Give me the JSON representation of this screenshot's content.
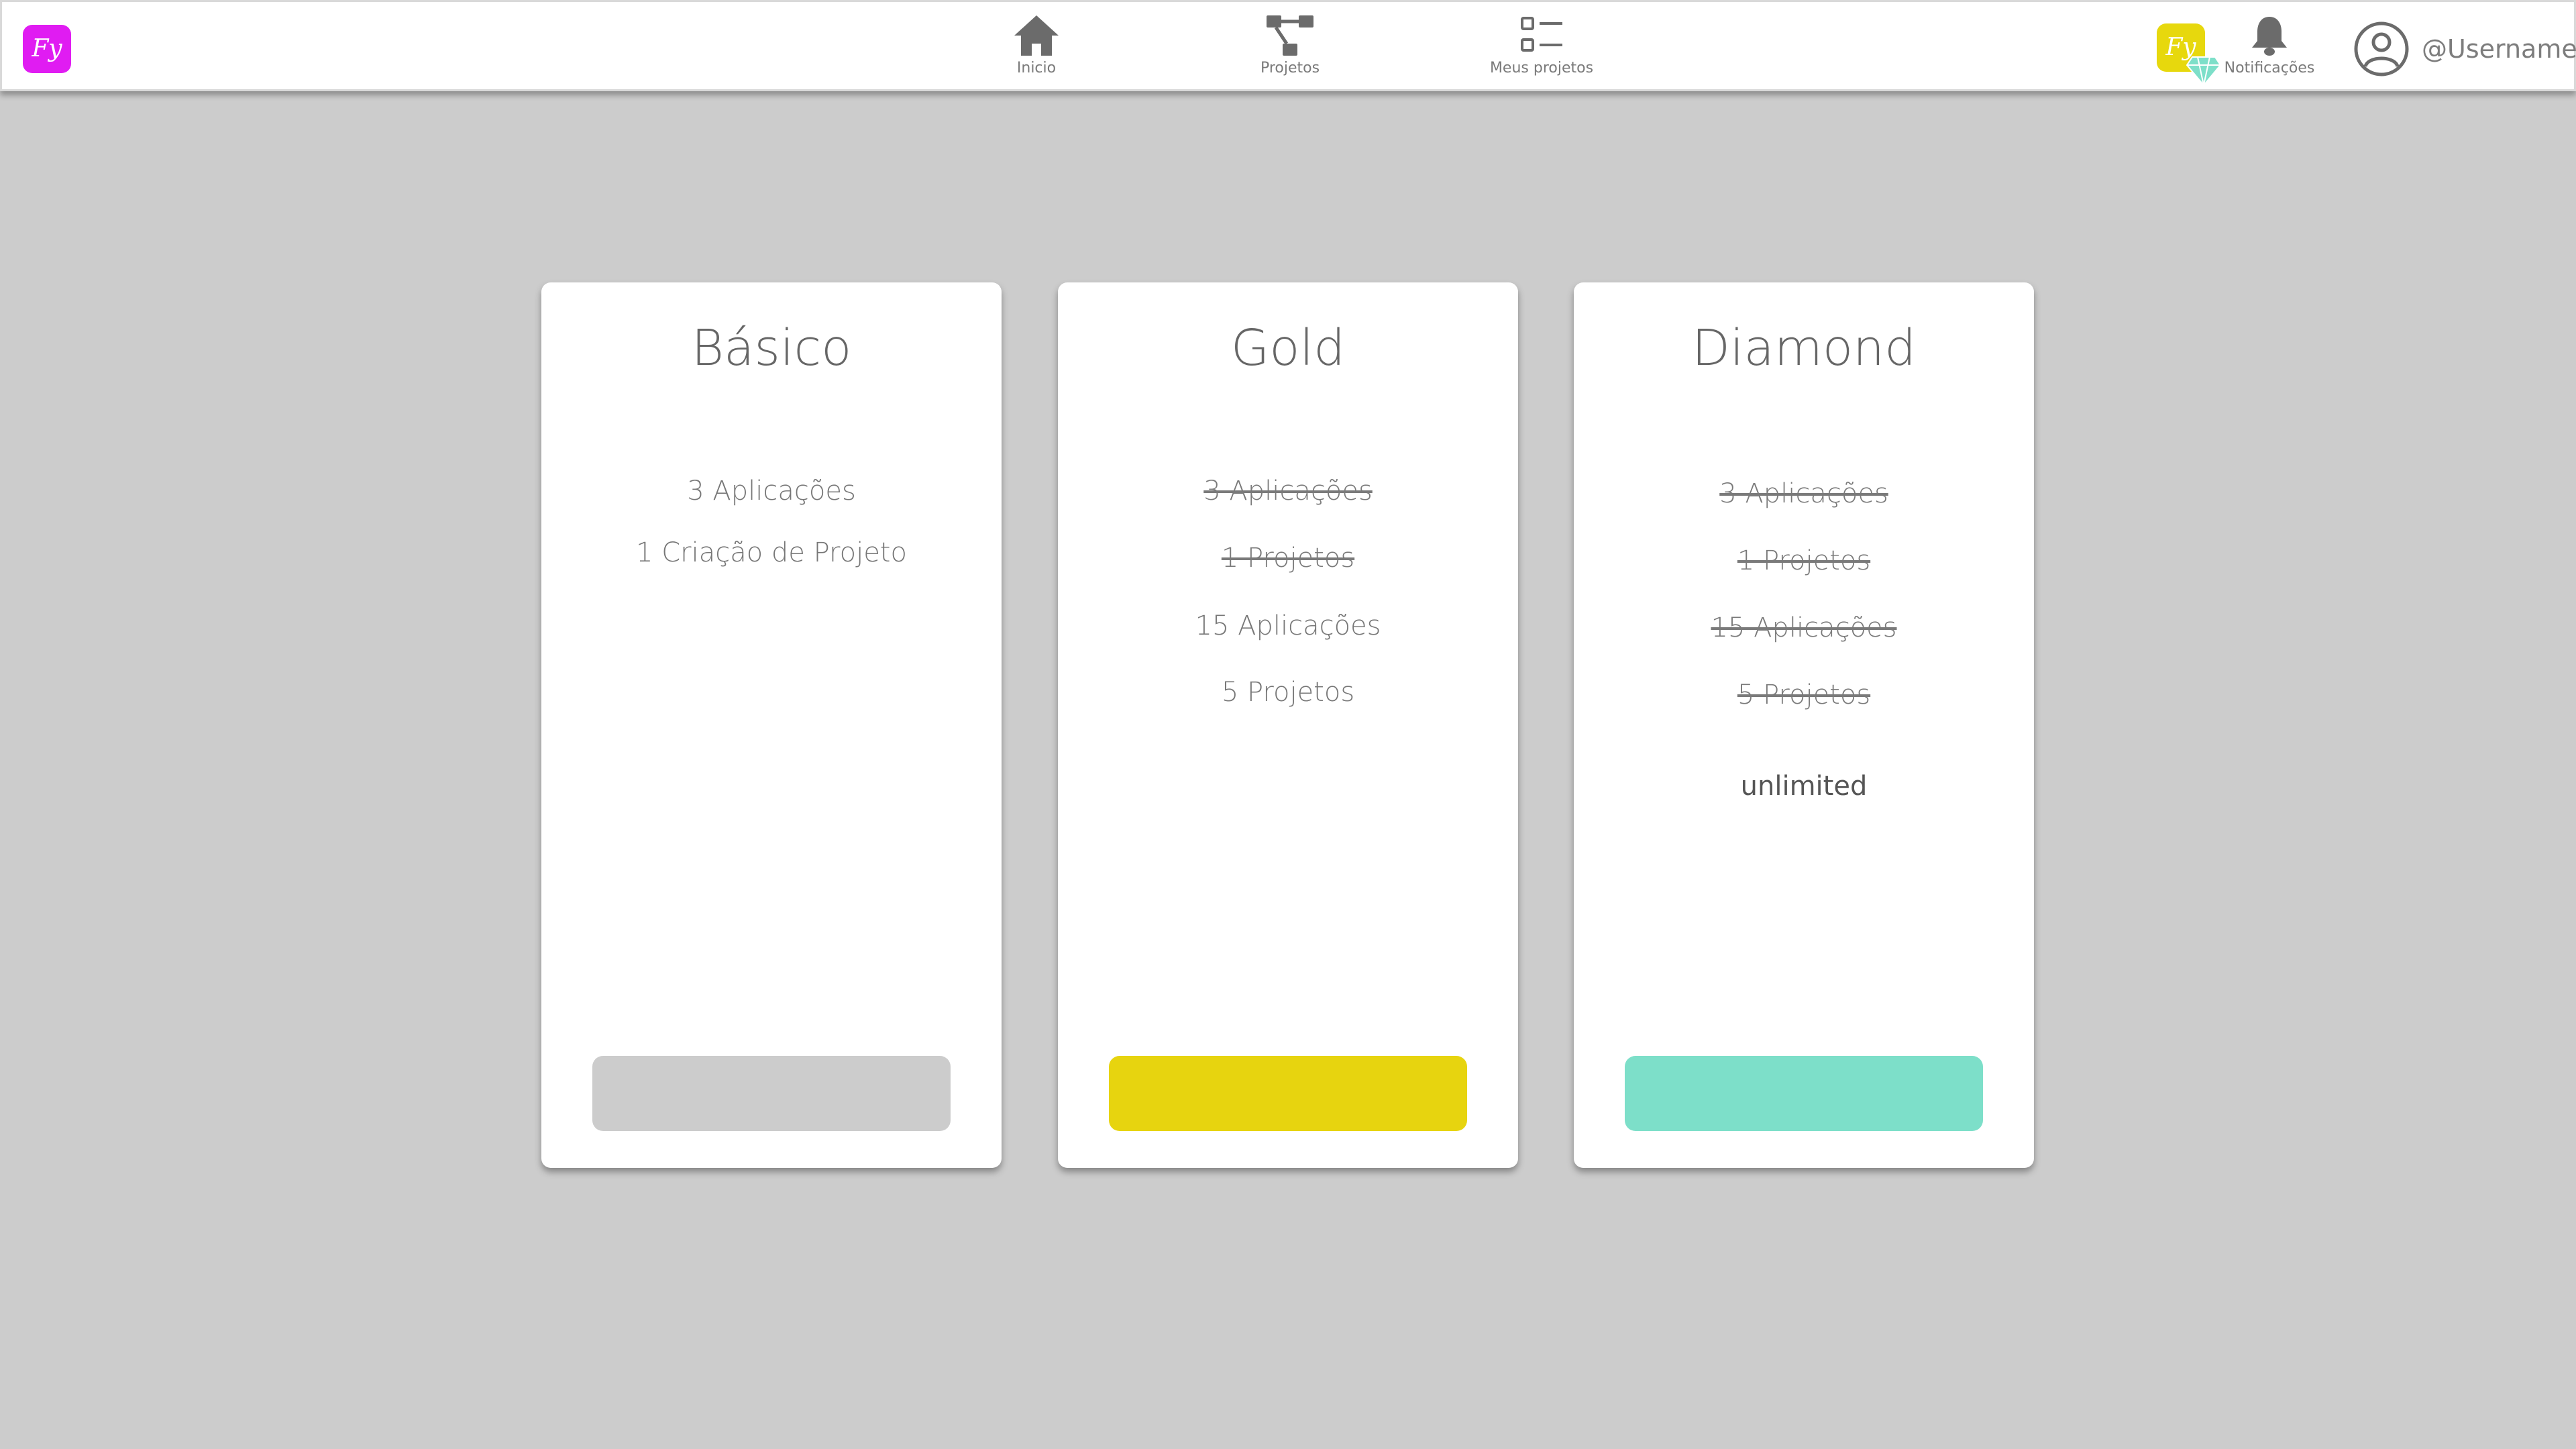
{
  "colors": {
    "brand_logo": "#e01cf2",
    "premium_logo": "#e7d80d",
    "diamond_accent": "#7ddfc9",
    "icon_gray": "#6b6b6b",
    "background": "#cccccc"
  },
  "header": {
    "logo_text": "Fy",
    "premium_logo_text": "Fy",
    "nav": [
      {
        "label": "Inicio",
        "icon": "home-icon"
      },
      {
        "label": "Projetos",
        "icon": "project-tree-icon"
      },
      {
        "label": "Meus projetos",
        "icon": "list-icon"
      }
    ],
    "notifications_label": "Notificações",
    "notifications_icon": "bell-icon",
    "badge_icon": "diamond-icon",
    "username": "@Username",
    "avatar_icon": "user-avatar-icon"
  },
  "plans": [
    {
      "name": "Básico",
      "button_color": "#cccccc",
      "features": [
        {
          "text": "3 Aplicações",
          "struck": false
        },
        {
          "text": "1 Criação de Projeto",
          "struck": false
        }
      ]
    },
    {
      "name": "Gold",
      "button_color": "#e7d40f",
      "features": [
        {
          "text": "3 Aplicações",
          "struck": true
        },
        {
          "text": "1 Projetos",
          "struck": true
        },
        {
          "text": "15 Aplicações",
          "struck": false
        },
        {
          "text": "5 Projetos",
          "struck": false
        }
      ]
    },
    {
      "name": "Diamond",
      "button_color": "#7ddfc9",
      "features": [
        {
          "text": "3 Aplicações",
          "struck": true
        },
        {
          "text": "1 Projetos",
          "struck": true
        },
        {
          "text": "15 Aplicações",
          "struck": true
        },
        {
          "text": "5 Projetos",
          "struck": true
        },
        {
          "text": "unlimited",
          "struck": false
        }
      ]
    }
  ]
}
